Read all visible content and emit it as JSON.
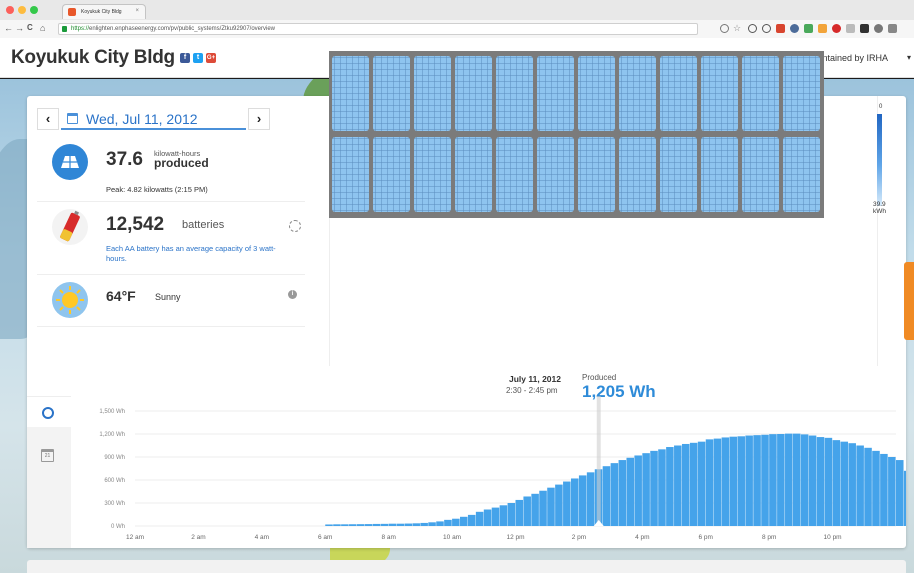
{
  "browser": {
    "tab_title": "Koyukuk City Bldg",
    "tab_close": "×",
    "url_scheme": "https://",
    "url_rest": "enlighten.enphaseenergy.com/pv/public_systems/Ztku92907/overview",
    "back": "←",
    "forward": "→",
    "reload": "C",
    "home": "⌂"
  },
  "header": {
    "title": "Koyukuk City Bldg",
    "social": [
      "f",
      "t",
      "G+"
    ],
    "maintained_by": "Maintained by IRHA",
    "maint_chevron": "▾"
  },
  "date_nav": {
    "prev": "‹",
    "next": "›",
    "date": "Wed, Jul 11, 2012"
  },
  "energy": {
    "value": "37.6",
    "unit_small": "kilowatt-hours",
    "unit_big": "produced",
    "peak": "Peak: 4.82 kilowatts (2:15 PM)"
  },
  "batteries": {
    "value": "12,542",
    "label": "batteries",
    "note": "Each AA battery has an average capacity of 3 watt-hours."
  },
  "weather": {
    "temp": "64°F",
    "condition": "Sunny",
    "info": "i"
  },
  "scale": {
    "top": "0",
    "bottom_value": "39.9",
    "bottom_unit": "kWh"
  },
  "chart_header": {
    "date": "July 11, 2012",
    "time": "2:30 - 2:45 pm",
    "produced_label": "Produced",
    "produced_value": "1,205 Wh"
  },
  "chart_tabs": {
    "calendar_day": "21"
  },
  "colors": {
    "accent": "#2e8bd8",
    "bar": "#45a3ea",
    "panel": "#8ec4ef",
    "orange": "#f08a24"
  },
  "chart_data": {
    "type": "bar",
    "ylabel_unit": "Wh",
    "y_ticks": [
      "1,500 Wh",
      "1,200 Wh",
      "900 Wh",
      "600 Wh",
      "300 Wh",
      "0 Wh"
    ],
    "y_tick_values": [
      1500,
      1200,
      900,
      600,
      300,
      0
    ],
    "ylim": [
      0,
      1500
    ],
    "x_ticks": [
      "12 am",
      "2 am",
      "4 am",
      "6 am",
      "8 am",
      "10 am",
      "12 pm",
      "2 pm",
      "4 pm",
      "6 pm",
      "8 pm",
      "10 pm"
    ],
    "x_tick_hours": [
      0,
      2,
      4,
      6,
      8,
      10,
      12,
      14,
      16,
      18,
      20,
      22
    ],
    "interval_minutes": 15,
    "selected_start_hour": 14.5,
    "start_hour": 6.0,
    "values": [
      20,
      22,
      22,
      23,
      24,
      25,
      27,
      28,
      30,
      30,
      32,
      35,
      40,
      48,
      60,
      80,
      95,
      120,
      145,
      185,
      215,
      240,
      270,
      300,
      340,
      385,
      420,
      460,
      500,
      540,
      580,
      620,
      660,
      700,
      740,
      780,
      820,
      860,
      890,
      920,
      950,
      980,
      1000,
      1030,
      1050,
      1070,
      1085,
      1100,
      1130,
      1140,
      1155,
      1165,
      1170,
      1180,
      1185,
      1190,
      1198,
      1200,
      1205,
      1205,
      1195,
      1180,
      1160,
      1150,
      1120,
      1100,
      1080,
      1050,
      1020,
      980,
      940,
      900,
      860,
      720,
      600,
      490,
      360,
      260,
      180,
      150,
      130,
      110,
      340,
      260,
      110,
      100,
      80,
      60,
      45,
      35,
      30,
      25,
      22,
      18,
      15,
      12
    ]
  }
}
